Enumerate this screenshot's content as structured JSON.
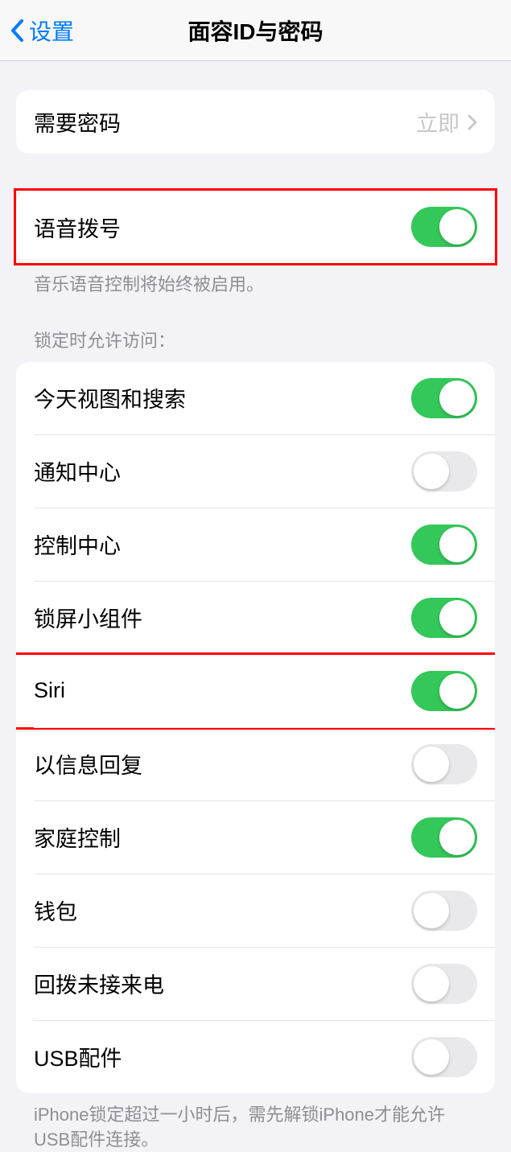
{
  "nav": {
    "back_label": "设置",
    "title": "面容ID与密码"
  },
  "require_passcode": {
    "label": "需要密码",
    "value": "立即"
  },
  "voice_dial": {
    "label": "语音拨号",
    "on": true,
    "footer": "音乐语音控制将始终被启用。"
  },
  "lock_access": {
    "header": "锁定时允许访问：",
    "items": [
      {
        "label": "今天视图和搜索",
        "on": true
      },
      {
        "label": "通知中心",
        "on": false
      },
      {
        "label": "控制中心",
        "on": true
      },
      {
        "label": "锁屏小组件",
        "on": true
      },
      {
        "label": "Siri",
        "on": true
      },
      {
        "label": "以信息回复",
        "on": false
      },
      {
        "label": "家庭控制",
        "on": true
      },
      {
        "label": "钱包",
        "on": false
      },
      {
        "label": "回拨未接来电",
        "on": false
      },
      {
        "label": "USB配件",
        "on": false
      }
    ],
    "footer": "iPhone锁定超过一小时后，需先解锁iPhone才能允许USB配件连接。"
  }
}
